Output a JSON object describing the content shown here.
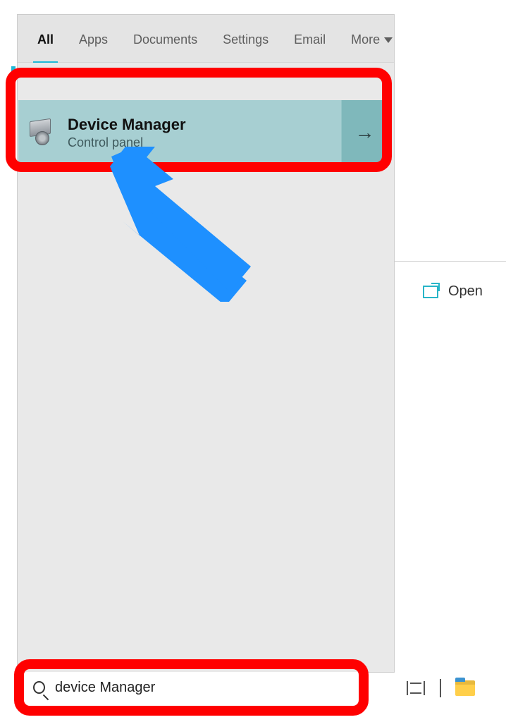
{
  "tabs": {
    "all": "All",
    "apps": "Apps",
    "documents": "Documents",
    "settings": "Settings",
    "email": "Email",
    "more": "More"
  },
  "result": {
    "title": "Device Manager",
    "subtitle": "Control panel",
    "expand_glyph": "→"
  },
  "detail": {
    "open": "Open"
  },
  "search": {
    "value": "device Manager"
  },
  "icons": {
    "device": "device-icon",
    "open": "open-icon",
    "search": "search-icon",
    "chevron_down": "chevron-down-icon",
    "arrow_right": "arrow-right-icon",
    "timeline": "timeline-icon",
    "divider": "divider-icon",
    "file_explorer": "file-explorer-icon"
  }
}
